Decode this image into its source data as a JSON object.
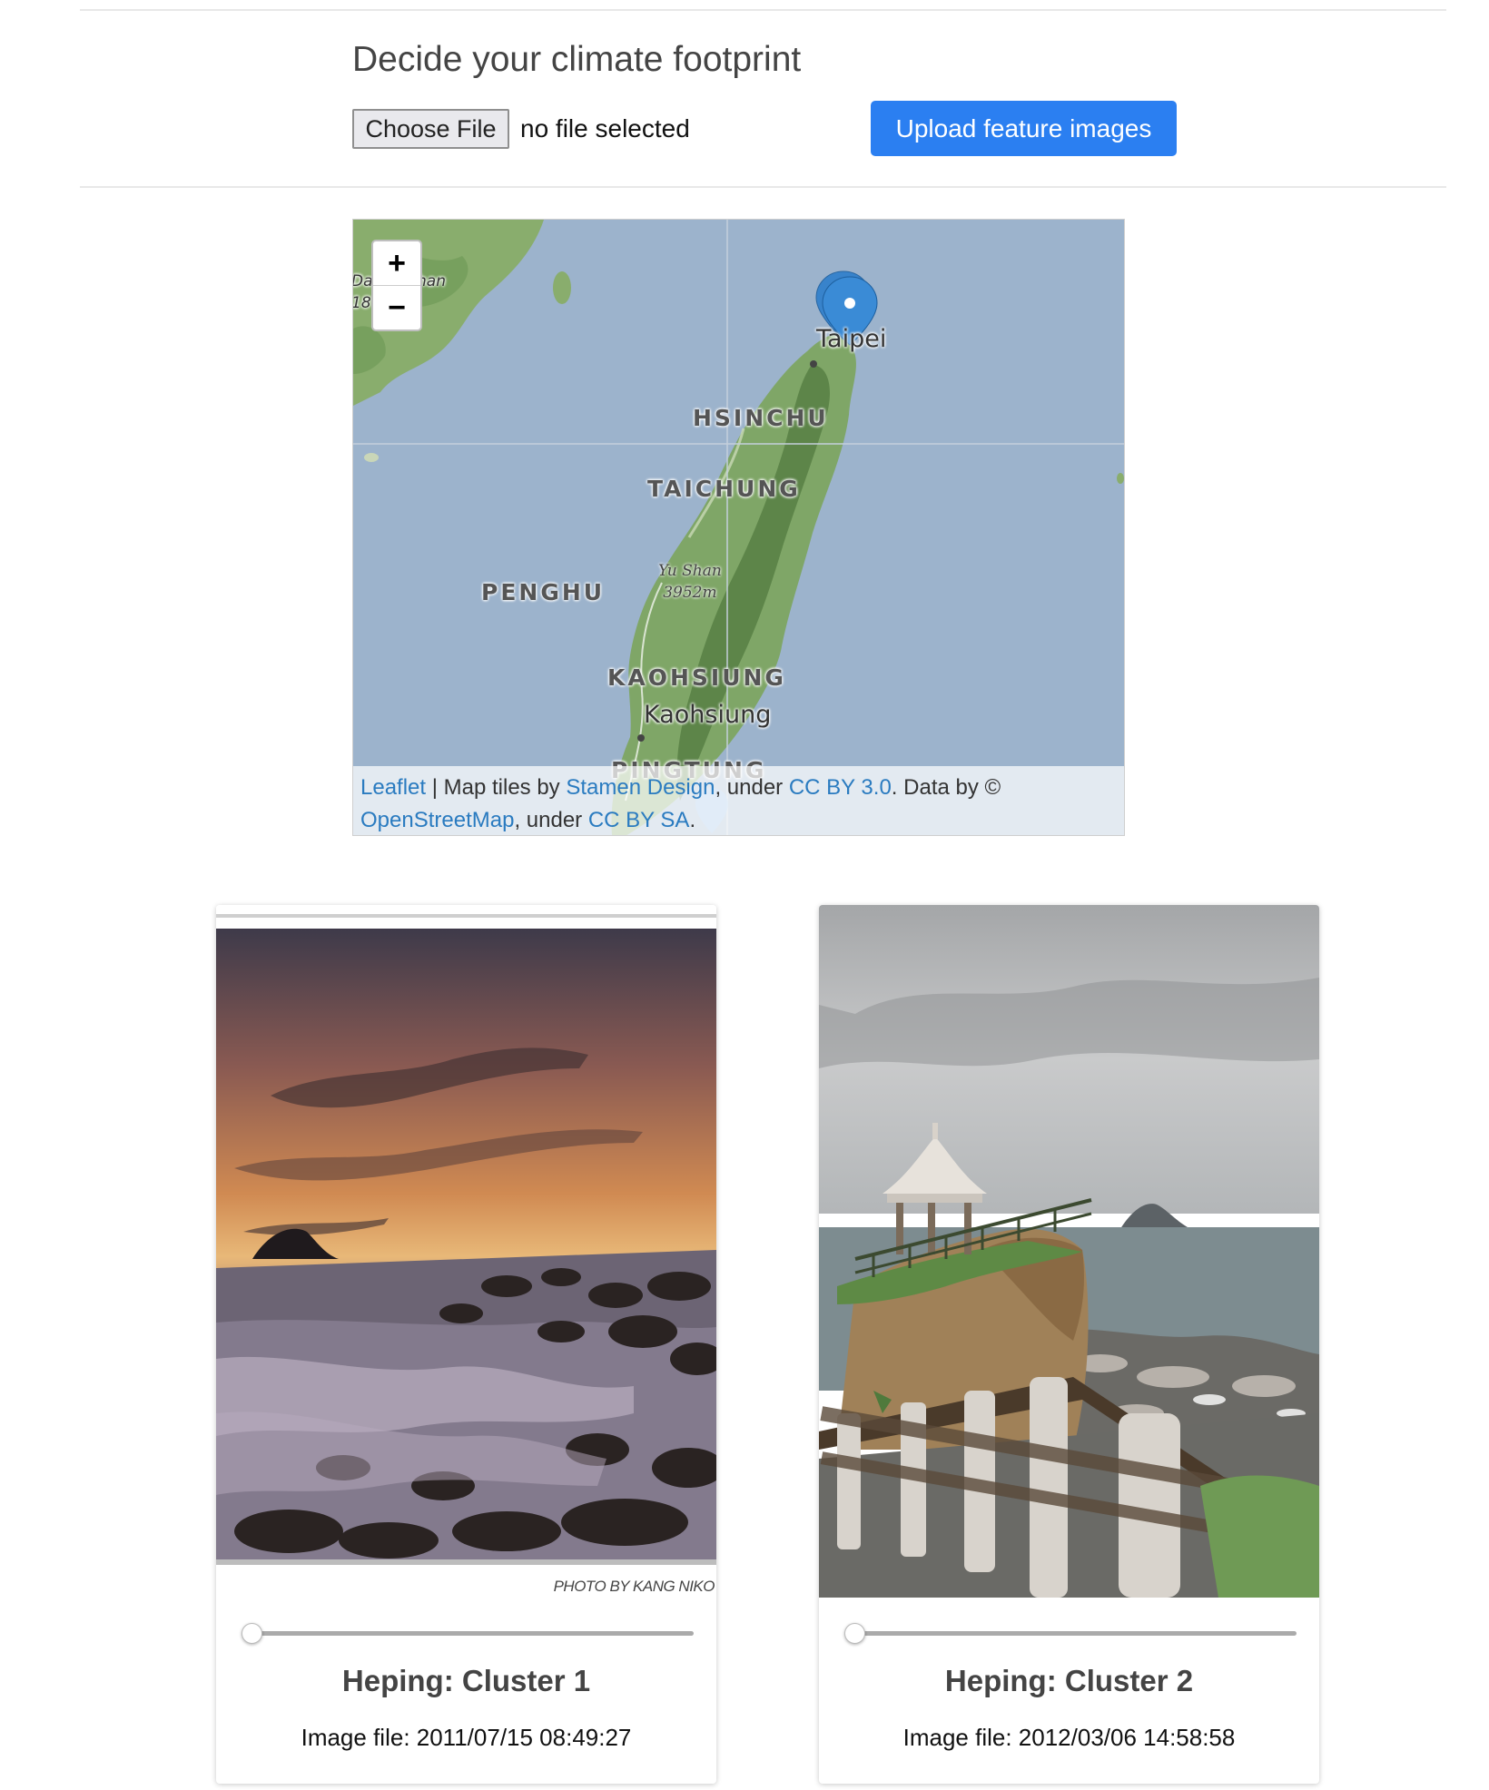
{
  "header": {
    "title": "Decide your climate footprint",
    "choose_file_label": "Choose File",
    "file_status": "no file selected",
    "upload_label": "Upload feature images"
  },
  "map": {
    "zoom_in": "+",
    "zoom_out": "−",
    "region_labels": [
      "HSINCHU",
      "TAICHUNG",
      "PENGHU",
      "KAOHSIUNG",
      "PINGTUNG"
    ],
    "cities": [
      "Taipei",
      "Kaohsiung"
    ],
    "corner_labels": [
      "Da",
      "han",
      "18"
    ],
    "peak_name": "Yu Shan",
    "peak_height": "3952m",
    "attribution": {
      "leaflet": "Leaflet",
      "sep": " | Map tiles by ",
      "stamen": "Stamen Design",
      "under1": ", under ",
      "cc_by": "CC BY 3.0",
      "data_by": ". Data by © ",
      "osm": "OpenStreetMap",
      "under2": ", under ",
      "cc_by_sa": "CC BY SA",
      "end": "."
    },
    "colors": {
      "sea": "#9cb3cc",
      "land": "#7fa667",
      "link": "#2a7bc0"
    }
  },
  "cards": [
    {
      "title": "Heping: Cluster 1",
      "file": "Image file: 2011/07/15 08:49:27",
      "credit": "PHOTO BY KANG NIKO",
      "slider_value": 0
    },
    {
      "title": "Heping: Cluster 2",
      "file": "Image file: 2012/03/06 14:58:58",
      "slider_value": 0
    }
  ]
}
